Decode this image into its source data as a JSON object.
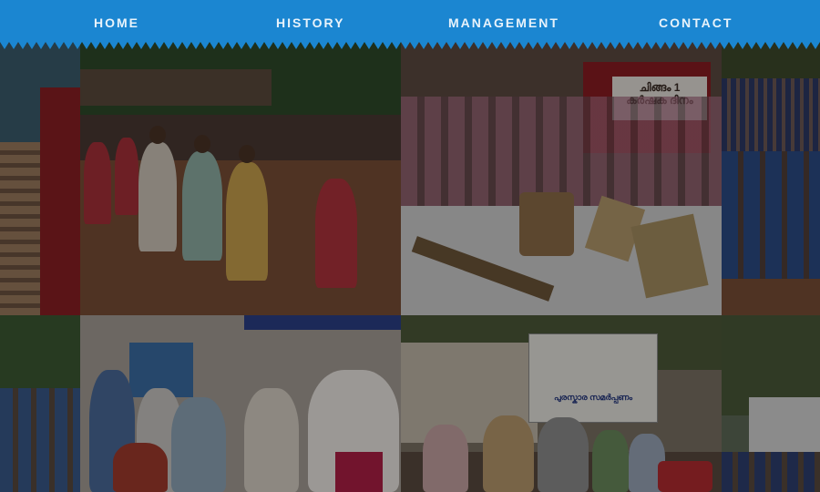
{
  "nav": {
    "items": [
      {
        "label": "HOME"
      },
      {
        "label": "HISTORY"
      },
      {
        "label": "MANAGEMENT"
      },
      {
        "label": "CONTACT"
      }
    ]
  },
  "gallery": {
    "tiles": [
      {
        "name": "left-edge-library-photo"
      },
      {
        "name": "procession-photo"
      },
      {
        "name": "farmers-day-exhibit-photo",
        "sign_text": "ചിങ്ങം 1\nകർഷക ദിനം"
      },
      {
        "name": "students-assembly-photo"
      },
      {
        "name": "left-edge-students-photo"
      },
      {
        "name": "award-presentation-photo"
      },
      {
        "name": "banner-event-photo",
        "banner_line": "പുരസ്കാര സമർപ്പണം"
      },
      {
        "name": "right-edge-school-photo"
      }
    ]
  },
  "colors": {
    "nav_bg": "#1b86d1",
    "nav_text": "#e8f3fb"
  }
}
